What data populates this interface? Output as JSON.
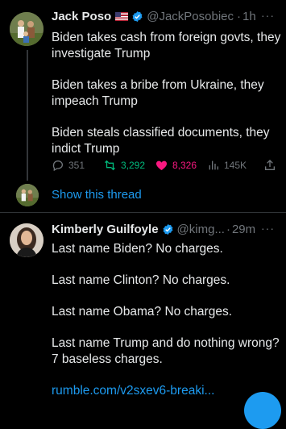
{
  "tweet1": {
    "author_name": "Jack Poso",
    "handle": "@JackPosobiec",
    "separator": "·",
    "time": "1h",
    "more": "···",
    "paragraphs": [
      "Biden takes cash from foreign govts, they investigate Trump",
      "Biden takes a bribe from Ukraine, they impeach Trump",
      "Biden steals classified documents, they indict Trump"
    ],
    "replies": "351",
    "retweets": "3,292",
    "likes": "8,326",
    "views": "145K",
    "show_thread": "Show this thread",
    "colors": {
      "retweet": "#00ba7c",
      "like": "#f91880",
      "link": "#1d9bf0"
    }
  },
  "tweet2": {
    "author_name": "Kimberly Guilfoyle",
    "handle": "@kimg...",
    "separator": "·",
    "time": "29m",
    "more": "···",
    "paragraphs": [
      "Last name Biden? No charges.",
      "Last name Clinton? No charges.",
      "Last name Obama? No charges.",
      "Last name Trump and do nothing wrong? 7 baseless charges."
    ],
    "link": "rumble.com/v2sxev6-breaki..."
  }
}
